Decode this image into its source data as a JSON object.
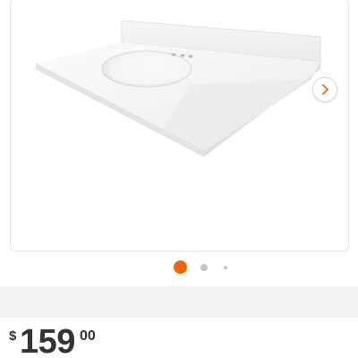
{
  "product": {
    "image_icon": "vanity-top-with-sink-image",
    "next_icon": "chevron-right-icon"
  },
  "carousel": {
    "total_images": 3,
    "active_index": 0,
    "active_color": "#f96302",
    "inactive_color": "#c4c4c4"
  },
  "price": {
    "currency_symbol": "$",
    "dollars": "159",
    "cents": "00"
  }
}
